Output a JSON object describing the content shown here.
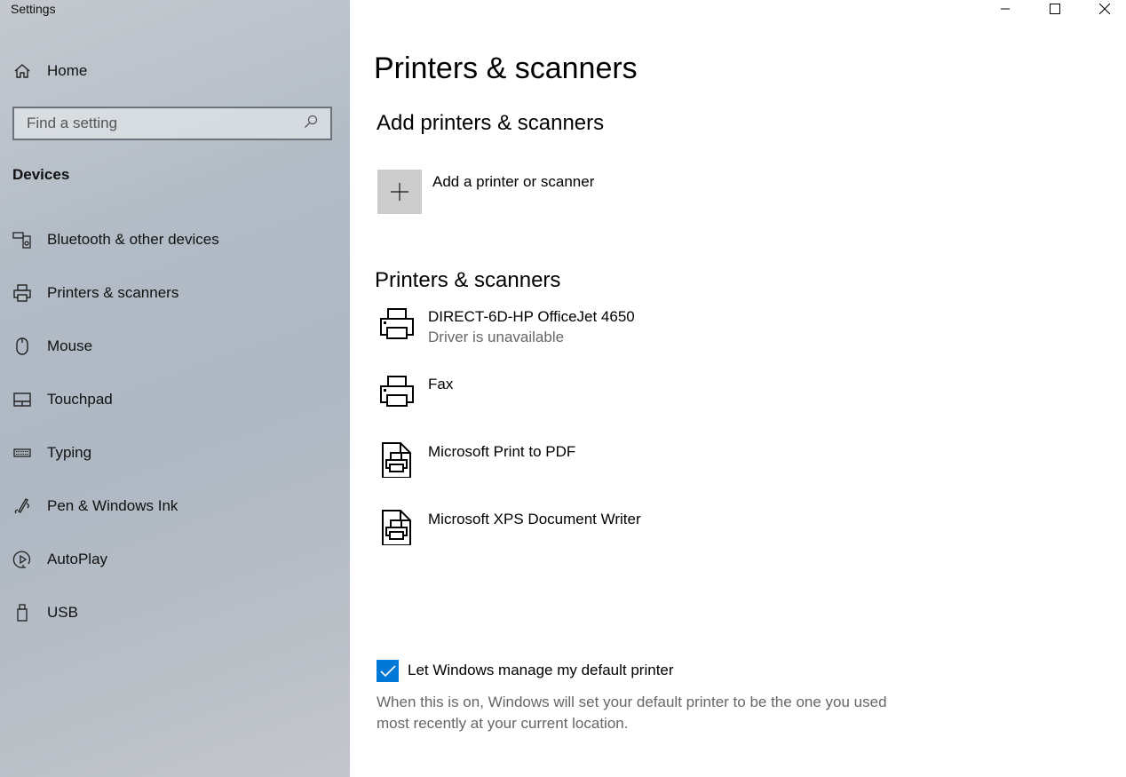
{
  "app_title": "Settings",
  "sidebar": {
    "home": "Home",
    "search_placeholder": "Find a setting",
    "section": "Devices",
    "items": [
      {
        "label": "Bluetooth & other devices",
        "icon": "bluetooth-devices-icon"
      },
      {
        "label": "Printers & scanners",
        "icon": "printer-icon"
      },
      {
        "label": "Mouse",
        "icon": "mouse-icon"
      },
      {
        "label": "Touchpad",
        "icon": "touchpad-icon"
      },
      {
        "label": "Typing",
        "icon": "keyboard-icon"
      },
      {
        "label": "Pen & Windows Ink",
        "icon": "pen-icon"
      },
      {
        "label": "AutoPlay",
        "icon": "autoplay-icon"
      },
      {
        "label": "USB",
        "icon": "usb-icon"
      }
    ]
  },
  "main": {
    "title": "Printers & scanners",
    "add_heading": "Add printers & scanners",
    "add_label": "Add a printer or scanner",
    "list_heading": "Printers & scanners",
    "devices": [
      {
        "name": "DIRECT-6D-HP OfficeJet 4650",
        "status": "Driver is unavailable",
        "icon": "printer-icon"
      },
      {
        "name": "Fax",
        "icon": "printer-icon"
      },
      {
        "name": "Microsoft Print to PDF",
        "icon": "document-printer-icon"
      },
      {
        "name": "Microsoft XPS Document Writer",
        "icon": "document-printer-icon"
      }
    ],
    "default_checkbox": {
      "label": "Let Windows manage my default printer",
      "checked": true
    },
    "description": "When this is on, Windows will set your default printer to be the one you used most recently at your current location."
  },
  "colors": {
    "accent": "#0078d7"
  }
}
